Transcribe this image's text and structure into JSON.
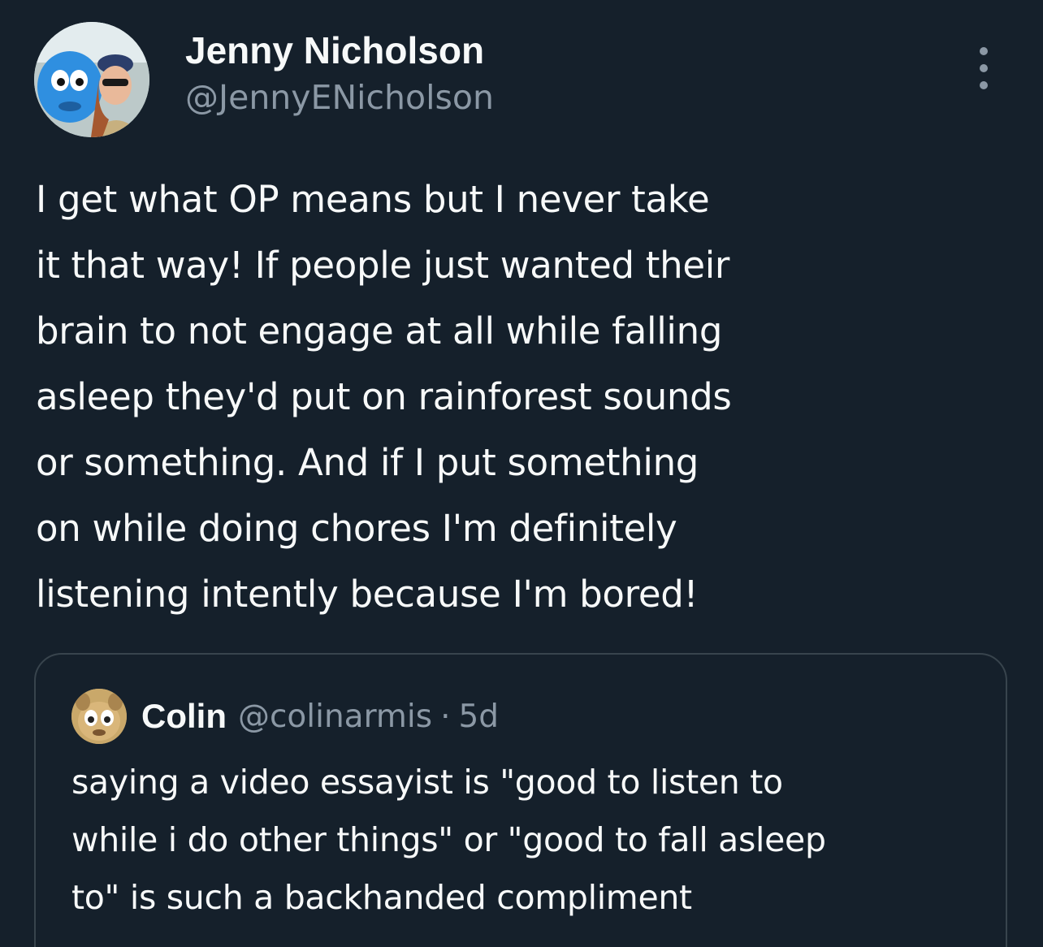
{
  "author": {
    "display_name": "Jenny Nicholson",
    "handle": "@JennyENicholson",
    "avatar_icon": "avatar-photo"
  },
  "more_options_icon": "more-vertical-icon",
  "tweet_text": "I get what OP means but I never take\nit that way! If people just wanted their\nbrain to not engage at all while falling\nasleep they'd put on rainforest sounds\nor something. And if I put something\non while doing chores I'm definitely\nlistening intently because I'm bored!",
  "quoted_tweet": {
    "display_name": "Colin",
    "handle": "@colinarmis",
    "separator": "·",
    "time": "5d",
    "avatar_icon": "avatar-cartoon",
    "text": "saying a video essayist is \"good to listen to\nwhile i do other things\" or \"good to fall asleep\nto\" is such a backhanded compliment"
  },
  "colors": {
    "background": "#15202b",
    "primary_text": "#f7f9f9",
    "secondary_text": "#8b98a5",
    "border": "#38444d"
  }
}
